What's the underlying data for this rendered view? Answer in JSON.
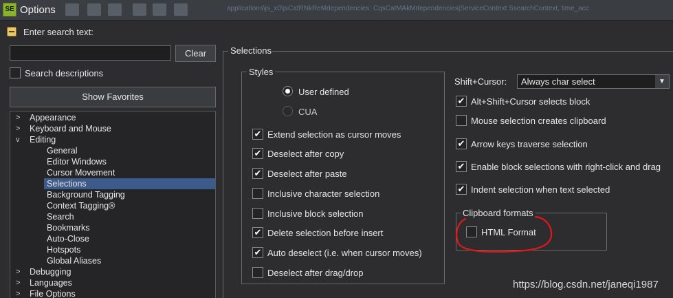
{
  "window": {
    "title": "Options",
    "app_icon_text": "SE",
    "path_text": "applications\\js_x0\\jsCatRNkReMdependencies: CqsCatMAkMdependencies|ServiceContext SsearchContext, time_acc",
    "toolbar_icons": [
      "toolbar-icon-1",
      "toolbar-icon-2",
      "toolbar-icon-3",
      "toolbar-icon-4",
      "toolbar-icon-5",
      "toolbar-icon-6"
    ]
  },
  "search": {
    "header": "Enter search text:",
    "input_value": "",
    "clear_label": "Clear",
    "descriptions_label": "Search descriptions",
    "descriptions_checked": false,
    "favorites_label": "Show Favorites"
  },
  "tree": [
    {
      "label": "Appearance",
      "level": 0,
      "arrow": ">"
    },
    {
      "label": "Keyboard and Mouse",
      "level": 0,
      "arrow": ">"
    },
    {
      "label": "Editing",
      "level": 0,
      "arrow": "v"
    },
    {
      "label": "General",
      "level": 1,
      "arrow": ""
    },
    {
      "label": "Editor Windows",
      "level": 1,
      "arrow": ""
    },
    {
      "label": "Cursor Movement",
      "level": 1,
      "arrow": ""
    },
    {
      "label": "Selections",
      "level": 1,
      "arrow": "",
      "selected": true
    },
    {
      "label": "Background Tagging",
      "level": 1,
      "arrow": ""
    },
    {
      "label": "Context Tagging®",
      "level": 1,
      "arrow": ""
    },
    {
      "label": "Search",
      "level": 1,
      "arrow": ""
    },
    {
      "label": "Bookmarks",
      "level": 1,
      "arrow": ""
    },
    {
      "label": "Auto-Close",
      "level": 1,
      "arrow": ""
    },
    {
      "label": "Hotspots",
      "level": 1,
      "arrow": ""
    },
    {
      "label": "Global Aliases",
      "level": 1,
      "arrow": ""
    },
    {
      "label": "Debugging",
      "level": 0,
      "arrow": ">"
    },
    {
      "label": "Languages",
      "level": 0,
      "arrow": ">"
    },
    {
      "label": "File Options",
      "level": 0,
      "arrow": ">"
    }
  ],
  "panel": {
    "section_title": "Selections",
    "styles": {
      "title": "Styles",
      "radios": [
        {
          "label": "User defined",
          "selected": true
        },
        {
          "label": "CUA",
          "selected": false
        }
      ],
      "checks": [
        {
          "label": "Extend selection as cursor moves",
          "checked": true
        },
        {
          "label": "Deselect after copy",
          "checked": true
        },
        {
          "label": "Deselect after paste",
          "checked": true
        },
        {
          "label": "Inclusive character selection",
          "checked": false
        },
        {
          "label": "Inclusive block selection",
          "checked": false
        },
        {
          "label": "Delete selection before insert",
          "checked": true
        },
        {
          "label": "Auto deselect (i.e. when cursor moves)",
          "checked": true
        },
        {
          "label": "Deselect after drag/drop",
          "checked": false
        }
      ]
    },
    "shift_cursor": {
      "label": "Shift+Cursor:",
      "value": "Always char select"
    },
    "right_checks": [
      {
        "label": "Alt+Shift+Cursor selects block",
        "checked": true
      },
      {
        "label": "Mouse selection creates clipboard",
        "checked": false
      },
      {
        "label": "Arrow keys traverse selection",
        "checked": true
      },
      {
        "label": "Enable block selections with right-click and drag",
        "checked": true
      },
      {
        "label": "Indent selection when text selected",
        "checked": true
      }
    ],
    "clipboard": {
      "title": "Clipboard formats",
      "checks": [
        {
          "label": "HTML Format",
          "checked": false
        }
      ]
    }
  },
  "watermark": "https://blog.csdn.net/janeqi1987",
  "colors": {
    "background": "#2d2d30",
    "selection": "#3c5a8a",
    "annotation_red": "#e01818"
  }
}
